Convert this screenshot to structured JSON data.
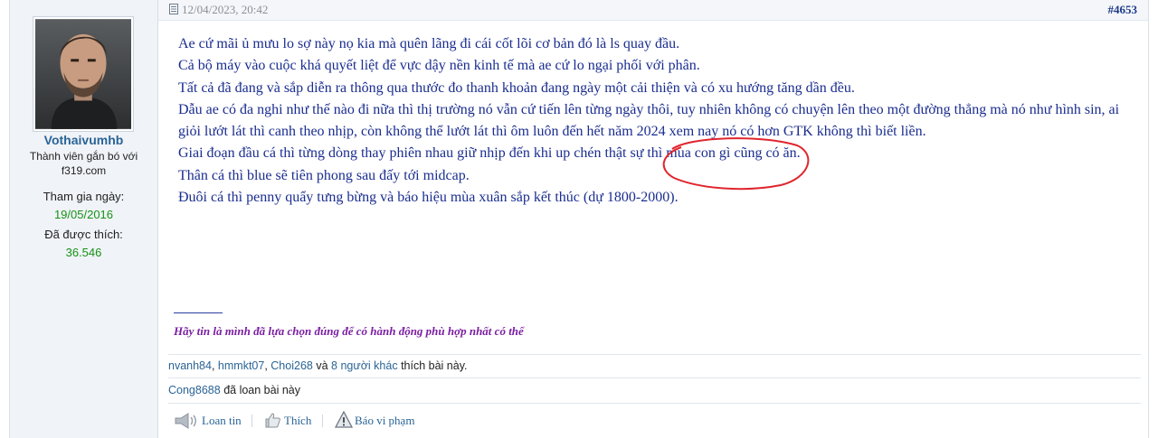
{
  "user": {
    "username": "Vothaivumhb",
    "title": "Thành viên gắn bó với f319.com",
    "joined_label": "Tham gia ngày:",
    "joined_value": "19/05/2016",
    "likes_label": "Đã được thích:",
    "likes_value": "36.546"
  },
  "post": {
    "date": "12/04/2023, 20:42",
    "number": "#4653",
    "lines": [
      "Ae cứ mãi ủ mưu lo sợ này nọ kia mà quên lãng đi cái cốt lõi cơ bản đó là ls quay đầu.",
      "Cả bộ máy vào cuộc khá quyết liệt để vực dậy nền kinh tế mà ae cứ lo ngại phối với phân.",
      "Tất cả đã đang và sắp diễn ra thông qua thước đo thanh khoản đang ngày một cải thiện và có xu hướng tăng dần đều.",
      "Dẫu ae có đa nghi như thế nào đi nữa thì thị trường nó vẫn cứ tiến lên từng ngày thôi, tuy nhiên không có chuyện lên theo một đường thẳng mà nó như hình sin, ai giỏi lướt lát thì canh theo nhịp, còn không thể lướt lát thì ôm luôn đến hết năm 2024 xem nay nó có hơn GTK không thì biết liền.",
      "Giai đoạn đầu cá thì từng dòng thay phiên nhau giữ nhịp đến khi up chén thật sự thì mua con gì cũng có ăn.",
      "Thân cá thì blue sẽ tiên phong sau đấy tới midcap.",
      "Đuôi cá thì penny quẩy tưng bừng và báo hiệu mùa xuân sắp kết thúc (dự 1800-2000)."
    ],
    "signature": "Hãy tin là mình đã lựa chọn đúng để có hành động phù hợp nhất có thể"
  },
  "likes": {
    "users": [
      "nvanh84",
      "hmmkt07",
      "Choi268"
    ],
    "and": "và",
    "others": "8 người khác",
    "suffix": "thích bài này."
  },
  "shares": {
    "user": "Cong8688",
    "suffix": "đã loan bài này"
  },
  "actions": {
    "share": "Loan tin",
    "like": "Thích",
    "report": "Báo vi phạm"
  },
  "colors": {
    "post_text": "#1a2d8f",
    "link": "#2a6496",
    "signature": "#7b1fa2",
    "annotation": "#e0262e",
    "stat_value": "#169216"
  }
}
